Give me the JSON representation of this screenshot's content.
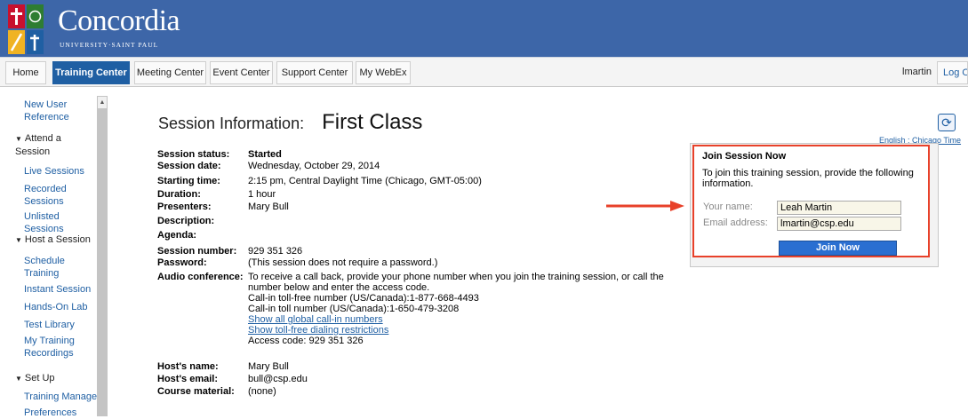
{
  "header": {
    "brand_name": "Concordia",
    "brand_sub": "UNIVERSITY·SAINT PAUL"
  },
  "nav": {
    "tabs": [
      {
        "label": "Home"
      },
      {
        "label": "Training Center"
      },
      {
        "label": "Meeting Center"
      },
      {
        "label": "Event Center"
      },
      {
        "label": "Support Center"
      },
      {
        "label": "My WebEx"
      }
    ],
    "active_tab": "Training Center",
    "user": "lmartin",
    "logout": "Log Out"
  },
  "sidebar": {
    "new_user_ref": "New User Reference",
    "sections": [
      {
        "title": "Attend a Session",
        "items": [
          "Live Sessions",
          "Recorded Sessions",
          "Unlisted Sessions"
        ]
      },
      {
        "title": "Host a Session",
        "items": [
          "Schedule Training",
          "Instant Session",
          "Hands-On Lab",
          "Test Library",
          "My Training Recordings"
        ]
      },
      {
        "title": "Set Up",
        "items": [
          "Training Manager",
          "Preferences"
        ]
      }
    ]
  },
  "session": {
    "title_label": "Session Information:",
    "title_value": "First Class",
    "language_link": "English : Chicago Time",
    "fields": [
      {
        "label": "Session status:",
        "value": "Started"
      },
      {
        "label": "Session date:",
        "value": "Wednesday, October 29, 2014"
      },
      {
        "label": "Starting time:",
        "value": "2:15 pm, Central Daylight Time (Chicago, GMT-05:00)"
      },
      {
        "label": "Duration:",
        "value": "1 hour"
      },
      {
        "label": "Presenters:",
        "value": "Mary Bull"
      },
      {
        "label": "Description:",
        "value": ""
      },
      {
        "label": "Agenda:",
        "value": ""
      },
      {
        "label": "Session number:",
        "value": "929 351 326"
      },
      {
        "label": "Password:",
        "value": "(This session does not require a password.)"
      }
    ],
    "audio": {
      "label": "Audio conference:",
      "line1": "To receive a call back, provide your phone number when you join the training session, or call the",
      "line2": "number below and enter the access code.",
      "tollfree": "Call-in toll-free number (US/Canada):1-877-668-4493",
      "toll": "Call-in toll number (US/Canada):1-650-479-3208",
      "link_global": "Show all global call-in numbers",
      "link_restrictions": "Show toll-free dialing restrictions",
      "access_code": "Access code: 929 351 326"
    },
    "host_fields": [
      {
        "label": "Host's name:",
        "value": "Mary Bull"
      },
      {
        "label": "Host's email:",
        "value": "bull@csp.edu"
      },
      {
        "label": "Course material:",
        "value": "(none)"
      }
    ]
  },
  "join": {
    "title": "Join Session Now",
    "description": "To join this training session, provide the following information.",
    "name_label": "Your name:",
    "name_value": "Leah Martin",
    "email_label": "Email address:",
    "email_value": "lmartin@csp.edu",
    "button": "Join Now"
  },
  "colors": {
    "header_bg": "#3d66a8",
    "accent": "#1f5fa3",
    "arrow": "#e8412a",
    "join_button": "#2a6fd1"
  }
}
